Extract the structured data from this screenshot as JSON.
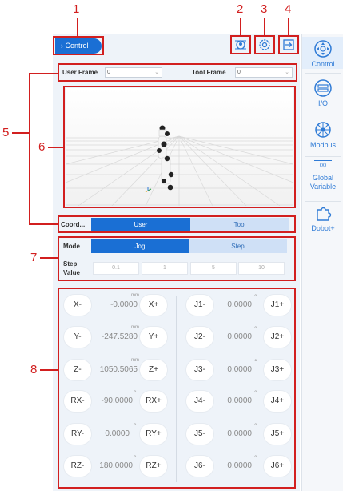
{
  "callouts": [
    "1",
    "2",
    "3",
    "4",
    "5",
    "6",
    "7",
    "8"
  ],
  "header": {
    "control_label": "Control"
  },
  "icons": {
    "top": [
      "pin-icon",
      "gear-icon",
      "exit-icon"
    ]
  },
  "frames": {
    "user_frame_label": "User Frame",
    "user_frame_value": "0",
    "tool_frame_label": "Tool Frame",
    "tool_frame_value": "0"
  },
  "coord": {
    "label": "Coord...",
    "options": [
      "User",
      "Tool"
    ],
    "selected": "User"
  },
  "mode": {
    "label": "Mode",
    "options": [
      "Jog",
      "Step"
    ],
    "selected": "Jog"
  },
  "step_value": {
    "label_line1": "Step",
    "label_line2": "Value",
    "options": [
      "0.1",
      "1",
      "5",
      "10"
    ]
  },
  "cartesian": [
    {
      "minus": "X-",
      "plus": "X+",
      "value": "-0.0000",
      "unit": "mm"
    },
    {
      "minus": "Y-",
      "plus": "Y+",
      "value": "-247.5280",
      "unit": "mm"
    },
    {
      "minus": "Z-",
      "plus": "Z+",
      "value": "1050.5065",
      "unit": "mm"
    },
    {
      "minus": "RX-",
      "plus": "RX+",
      "value": "-90.0000",
      "unit": "°"
    },
    {
      "minus": "RY-",
      "plus": "RY+",
      "value": "0.0000",
      "unit": "°"
    },
    {
      "minus": "RZ-",
      "plus": "RZ+",
      "value": "180.0000",
      "unit": "°"
    }
  ],
  "joints": [
    {
      "minus": "J1-",
      "plus": "J1+",
      "value": "0.0000",
      "unit": "°"
    },
    {
      "minus": "J2-",
      "plus": "J2+",
      "value": "0.0000",
      "unit": "°"
    },
    {
      "minus": "J3-",
      "plus": "J3+",
      "value": "0.0000",
      "unit": "°"
    },
    {
      "minus": "J4-",
      "plus": "J4+",
      "value": "0.0000",
      "unit": "°"
    },
    {
      "minus": "J5-",
      "plus": "J5+",
      "value": "0.0000",
      "unit": "°"
    },
    {
      "minus": "J6-",
      "plus": "J6+",
      "value": "0.0000",
      "unit": "°"
    }
  ],
  "sidebar": {
    "items": [
      {
        "label": "Control",
        "icon": "control-icon",
        "active": true
      },
      {
        "label": "I/O",
        "icon": "io-icon"
      },
      {
        "label": "Modbus",
        "icon": "modbus-icon"
      },
      {
        "label_line1": "Global",
        "label_line2": "Variable",
        "icon": "global-variable-icon",
        "badge": "(x)"
      },
      {
        "label": "Dobot+",
        "icon": "dobot-plus-icon"
      }
    ]
  },
  "colors": {
    "accent": "#1a6fd4",
    "callout": "#d21f1f",
    "panel": "#eef3f9"
  }
}
